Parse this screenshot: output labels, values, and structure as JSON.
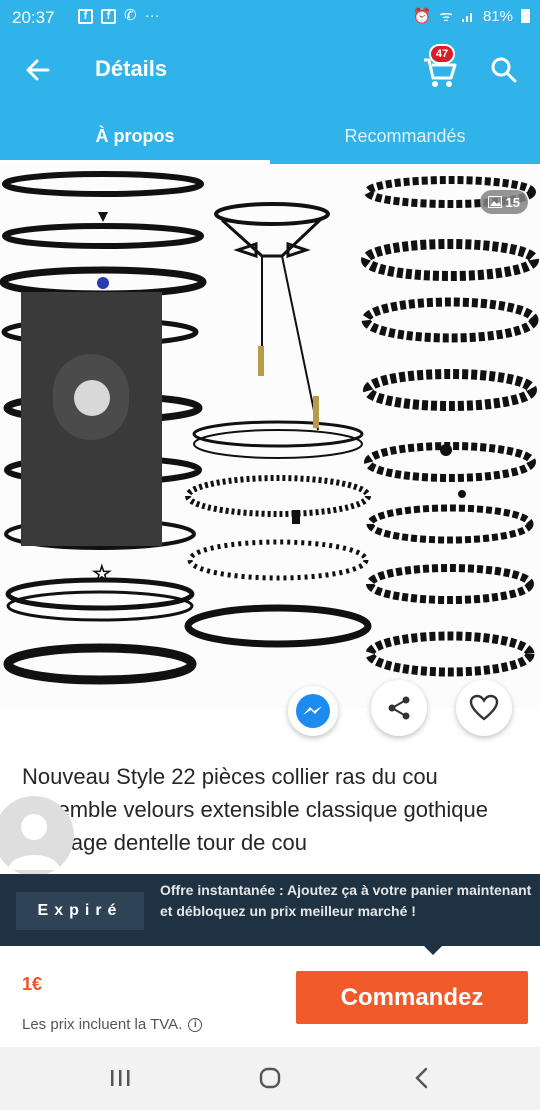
{
  "status_bar": {
    "time": "20:37",
    "fb_label": "f",
    "phone_glyph": "✆",
    "more_glyph": "···",
    "alarm_glyph": "⏰",
    "wifi_glyph": "ᯤ",
    "battery_text": "81%"
  },
  "app_bar": {
    "title": "Détails",
    "cart_count": "47",
    "back_icon": "arrow-left-icon",
    "cart_icon": "shopping-cart-icon",
    "search_icon": "search-icon"
  },
  "tabs": [
    {
      "label": "À propos",
      "active": true
    },
    {
      "label": "Recommandés",
      "active": false
    }
  ],
  "product": {
    "photo_count": "15",
    "title": "Nouveau Style 22 pièces collier ras du cou ensemble velours extensible classique gothique tatouage dentelle tour de cou"
  },
  "offer": {
    "tag": "Expiré",
    "text": "Offre instantanée : Ajoutez ça à votre panier maintenant et débloquez un prix meilleur marché !"
  },
  "footer": {
    "price": "1€",
    "vat_note": "Les prix incluent la TVA.",
    "info_glyph": "i",
    "order_label": "Commandez"
  },
  "colors": {
    "brand_blue": "#2fb3e8",
    "order_orange": "#f15a2b",
    "price_orange": "#f0532a",
    "banner_navy": "#1f3243",
    "badge_red": "#d91e2a"
  }
}
